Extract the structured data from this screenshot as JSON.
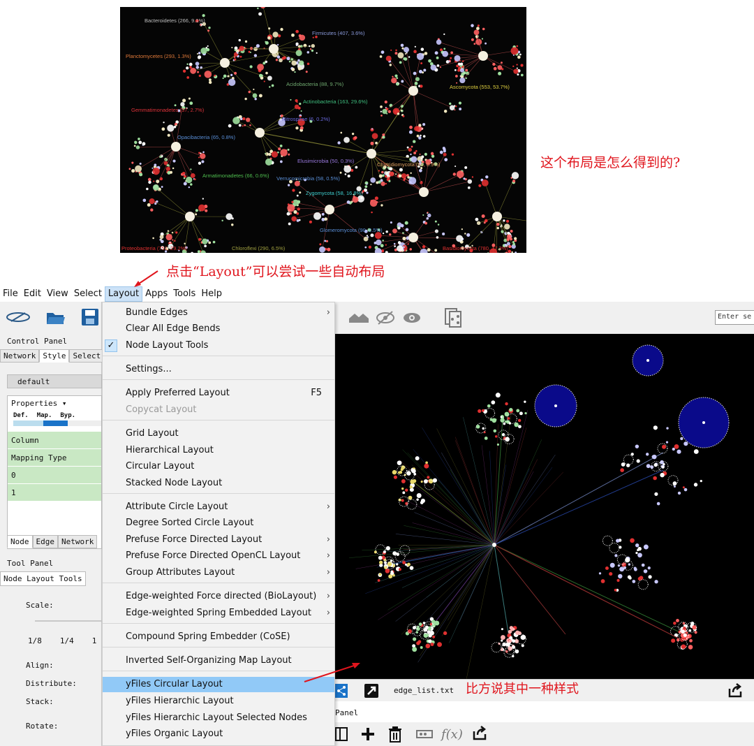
{
  "annotations": {
    "question": "这个布局是怎么得到的?",
    "click_hint": "点击“Layout”可以尝试一些自动布局",
    "example": "比方说其中一种样式"
  },
  "reference_image": {
    "labels": [
      {
        "text": "Bacteroidetes (266, 9.1%)",
        "color": "#bdbdbd"
      },
      {
        "text": "Firmicutes (407, 3.6%)",
        "color": "#8b9bdc"
      },
      {
        "text": "Planctomycetes (293, 1.3%)",
        "color": "#e07a3a"
      },
      {
        "text": "Acidobacteria (88, 9.7%)",
        "color": "#6fa86f"
      },
      {
        "text": "Actinobacteria (163, 29.6%)",
        "color": "#3fbf7f"
      },
      {
        "text": "Gemmatimonadetes (37, 2.7%)",
        "color": "#e0333a"
      },
      {
        "text": "Nitrospirae (6, 0.2%)",
        "color": "#6a6adf"
      },
      {
        "text": "Opacibacteria (65, 0.8%)",
        "color": "#5a8fd8"
      },
      {
        "text": "Elusimicrobia (50, 0.3%)",
        "color": "#9a7adf"
      },
      {
        "text": "Armatimonadetes (66, 0.6%)",
        "color": "#4fbf4f"
      },
      {
        "text": "Verrucomicrobia (58, 0.5%)",
        "color": "#5a8fd8"
      },
      {
        "text": "Zygomycota (58, 16.8%)",
        "color": "#3fcfcf"
      },
      {
        "text": "Chytridiomycota (66, 0.9%)",
        "color": "#e0a060"
      },
      {
        "text": "Ascomycota (553, 53.7%)",
        "color": "#e0d040"
      },
      {
        "text": "Glomeromycota (90, 0.5%)",
        "color": "#5a8fd8"
      },
      {
        "text": "Proteobacteria (751, 29.2%)",
        "color": "#e03030"
      },
      {
        "text": "Chloroflexi (290, 6.5%)",
        "color": "#a0a040"
      },
      {
        "text": "Basidiomycota (780, 17.3%)",
        "color": "#e03030"
      }
    ]
  },
  "menubar": [
    "File",
    "Edit",
    "View",
    "Select",
    "Layout",
    "Apps",
    "Tools",
    "Help"
  ],
  "menubar_active": "Layout",
  "left_panel": {
    "control_panel_title": "Control Panel",
    "tabs": [
      "Network",
      "Style",
      "Select"
    ],
    "selected_tab": "Style",
    "style_name": "default",
    "properties_label": "Properties",
    "columns": [
      "Def.",
      "Map.",
      "Byp."
    ],
    "rows": [
      "Column",
      "Mapping Type",
      "0",
      "1"
    ],
    "bottom_tabs": [
      "Node",
      "Edge",
      "Network"
    ],
    "tool_panel_title": "Tool Panel",
    "tool_tab": "Node Layout Tools",
    "scale_label": "Scale:",
    "scale_ticks": [
      "1/8",
      "1/4",
      "1"
    ],
    "align_label": "Align:",
    "distribute_label": "Distribute:",
    "stack_label": "Stack:",
    "rotate_label": "Rotate:"
  },
  "layout_menu": {
    "items": [
      {
        "label": "Bundle Edges",
        "arrow": true
      },
      {
        "label": "Clear All Edge Bends"
      },
      {
        "label": "Node Layout Tools",
        "checked": true
      },
      {
        "label": "Settings..."
      },
      {
        "label": "Apply Preferred Layout",
        "shortcut": "F5"
      },
      {
        "label": "Copycat Layout",
        "disabled": true
      },
      {
        "label": "Grid Layout"
      },
      {
        "label": "Hierarchical Layout"
      },
      {
        "label": "Circular Layout"
      },
      {
        "label": "Stacked Node Layout"
      },
      {
        "label": "Attribute Circle Layout",
        "arrow": true
      },
      {
        "label": "Degree Sorted Circle Layout"
      },
      {
        "label": "Prefuse Force Directed Layout",
        "arrow": true
      },
      {
        "label": "Prefuse Force Directed OpenCL Layout",
        "arrow": true
      },
      {
        "label": "Group Attributes Layout",
        "arrow": true
      },
      {
        "label": "Edge-weighted Force directed (BioLayout)",
        "arrow": true
      },
      {
        "label": "Edge-weighted Spring Embedded Layout",
        "arrow": true
      },
      {
        "label": "Compound Spring Embedder (CoSE)"
      },
      {
        "label": "Inverted Self-Organizing Map Layout"
      },
      {
        "label": "yFiles Circular Layout",
        "highlighted": true
      },
      {
        "label": "yFiles Hierarchic Layout"
      },
      {
        "label": "yFiles Hierarchic Layout Selected Nodes"
      },
      {
        "label": "yFiles Organic Layout"
      }
    ],
    "checkmark": "✓",
    "arrow_glyph": "›"
  },
  "network_view": {
    "search_placeholder": "Enter se",
    "file_name": "edge_list.txt",
    "panel_label": "Panel"
  },
  "colors": {
    "annotation_red": "#e0151d",
    "menu_highlight": "#91c9f7",
    "canvas_bg": "#000000",
    "accent_blue": "#1a73c8"
  }
}
